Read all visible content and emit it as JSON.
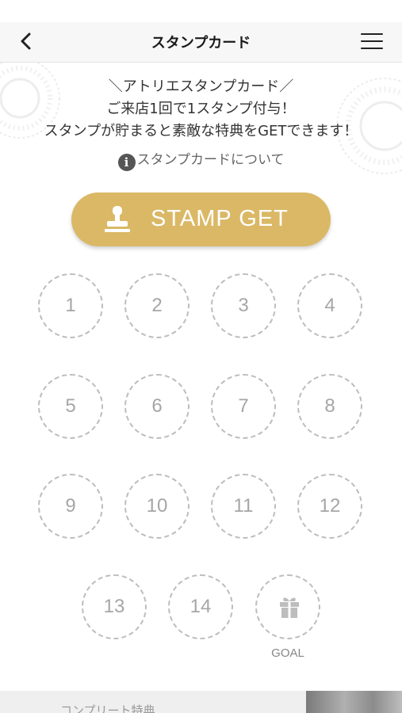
{
  "header": {
    "title": "スタンプカード"
  },
  "intro": {
    "line1": "＼アトリエスタンプカード／",
    "line2": "ご来店1回で1スタンプ付与！",
    "line3": "スタンプが貯まると素敵な特典をGETできます！",
    "info_link": "スタンプカードについて"
  },
  "stamp_button": {
    "label": "STAMP GET"
  },
  "slots": [
    "1",
    "2",
    "3",
    "4",
    "5",
    "6",
    "7",
    "8",
    "9",
    "10",
    "11",
    "12",
    "13",
    "14"
  ],
  "goal": {
    "label": "GOAL"
  },
  "complete": {
    "label": "コンプリート特典"
  },
  "colors": {
    "accent": "#dab866",
    "slot_border": "#bdbdbd",
    "slot_text": "#a6a6a6"
  },
  "icons": {
    "back": "chevron-left-icon",
    "menu": "hamburger-menu-icon",
    "info": "info-circle-icon",
    "stamp": "stamp-icon",
    "gift": "gift-icon"
  }
}
